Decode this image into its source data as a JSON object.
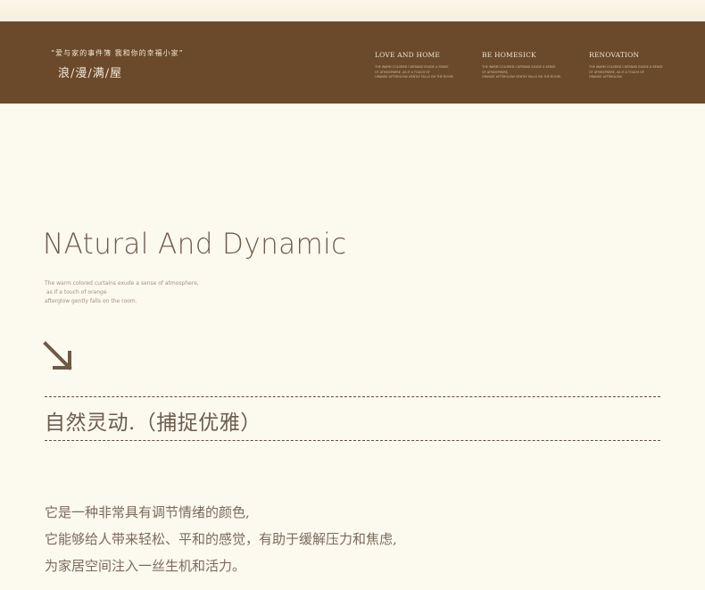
{
  "banner": {
    "quote": "“爱与家的事件簿 我和你的幸福小家”",
    "brand": "浪/漫/满/屋",
    "columns": [
      {
        "title": "LOVE AND HOME",
        "lines": [
          "THE WARM COLORED CURTAINS EXUDE A SENSE",
          "OF ATMOSPHERE, AS IF A TOUCH OF",
          "ORANGE AFTERGLOW GENTLY FALLS ON THE ROOM."
        ]
      },
      {
        "title": "BE HOMESICK",
        "lines": [
          "THE WARM COLORED CURTAINS EXUDE A SENSE",
          "OF ATMOSPHERE,",
          "ORANGE AFTERGLOW GENTLY FALLS ON THE ROOM."
        ]
      },
      {
        "title": "RENOVATION",
        "lines": [
          "THE WARM COLORED CURTAINS EXUDE A SENSE",
          "OF ATMOSPHERE, AS IF A TOUCH OF",
          "ORANGE AFTERGLOW."
        ]
      }
    ]
  },
  "main": {
    "headline": "NAtural And Dynamic",
    "subtitle_lines": [
      "The warm colored curtains exude a sense of atmosphere,",
      " as if a touch of orange",
      "afterglow gently falls on the room."
    ],
    "arrow_icon": "arrow-down-right-icon",
    "cn_title": "自然灵动.（捕捉优雅）",
    "paragraph_lines": [
      "它是一种非常具有调节情绪的颜色,",
      "它能够给人带来轻松、平和的感觉，有助于缓解压力和焦虑,",
      "为家居空间注入一丝生机和活力。"
    ]
  },
  "colors": {
    "banner": "#6b4a2b",
    "background": "#fcf9ef",
    "text": "#7a6a5a"
  }
}
